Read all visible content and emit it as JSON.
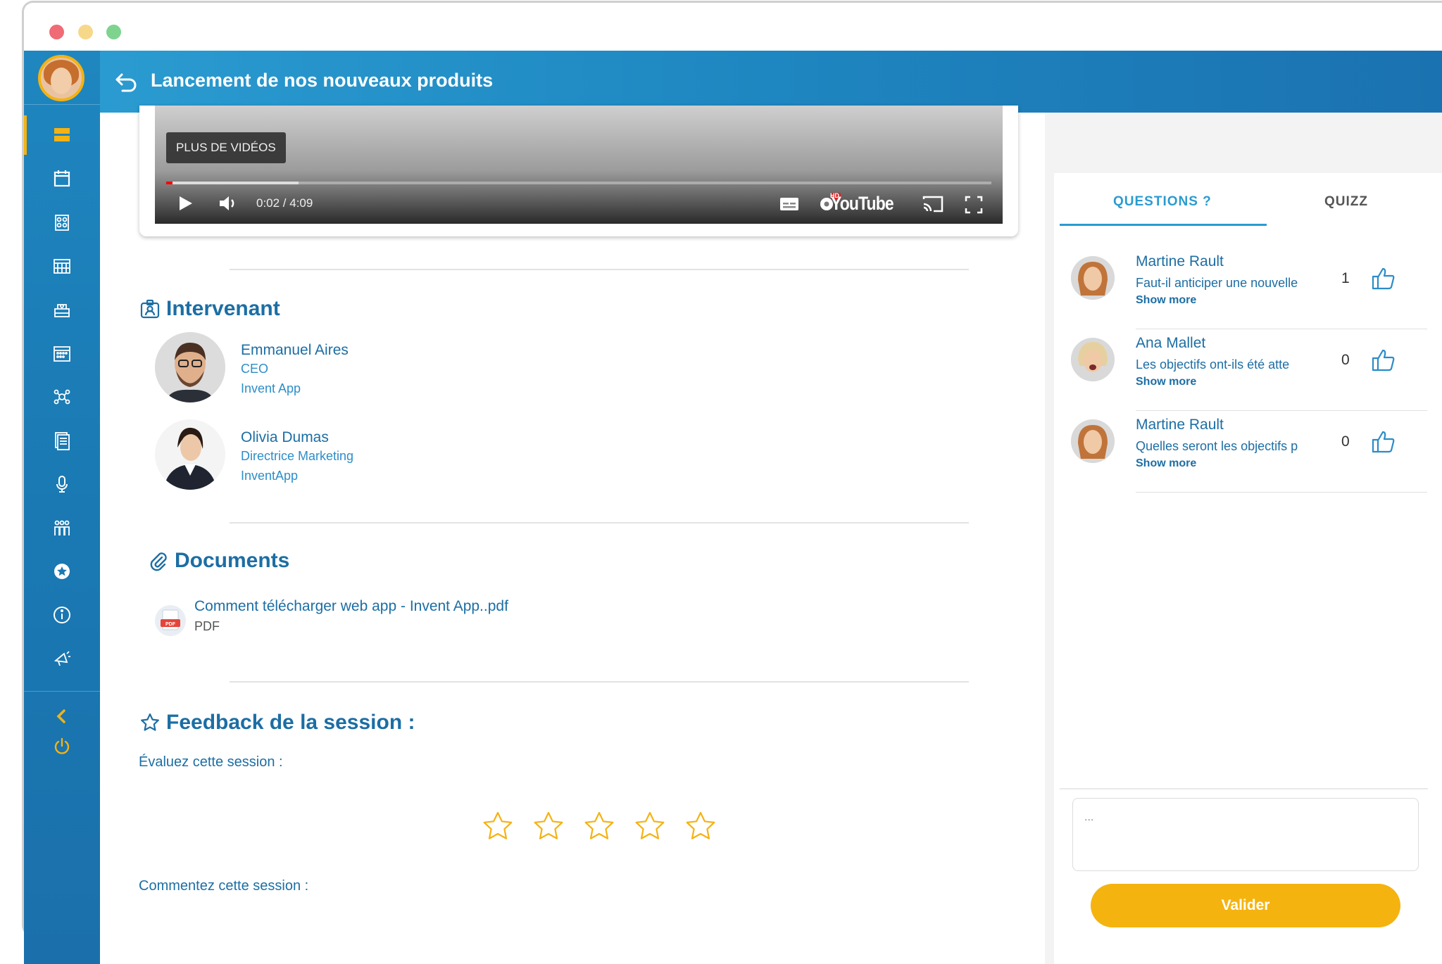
{
  "header": {
    "title": "Lancement de nos nouveaux produits"
  },
  "video": {
    "more_videos": "PLUS DE VIDÉOS",
    "time": "0:02 / 4:09",
    "brand": "YouTube",
    "hd_badge": "HD",
    "progress_played": 0.008,
    "progress_buffered": 0.16
  },
  "speakers_section": {
    "title": "Intervenant",
    "speakers": [
      {
        "name": "Emmanuel Aires",
        "role": "CEO",
        "company": "Invent App"
      },
      {
        "name": "Olivia Dumas",
        "role": "Directrice Marketing",
        "company": "InventApp"
      }
    ]
  },
  "documents_section": {
    "title": "Documents",
    "badge": "PDF",
    "items": [
      {
        "name": "Comment télécharger web app - Invent App..pdf",
        "type": "PDF"
      }
    ]
  },
  "feedback": {
    "title": "Feedback de la session :",
    "rate_label": "Évaluez cette session :",
    "comment_label": "Commentez cette session :",
    "rating": 0,
    "max_rating": 5
  },
  "right_panel": {
    "tabs": [
      {
        "label": "QUESTIONS ?",
        "active": true
      },
      {
        "label": "QUIZZ",
        "active": false
      }
    ],
    "questions": [
      {
        "author": "Martine Rault",
        "text": "Faut-il anticiper une nouvelle",
        "more": "Show more",
        "likes": "1"
      },
      {
        "author": "Ana Mallet",
        "text": "Les objectifs ont-ils été atte",
        "more": "Show more",
        "likes": "0"
      },
      {
        "author": "Martine Rault",
        "text": "Quelles seront les objectifs p",
        "more": "Show more",
        "likes": "0"
      }
    ],
    "input_placeholder": "...",
    "submit_label": "Valider"
  },
  "colors": {
    "primary": "#1c6ea4",
    "accent": "#f5b30f",
    "header": "#1e86c0"
  }
}
